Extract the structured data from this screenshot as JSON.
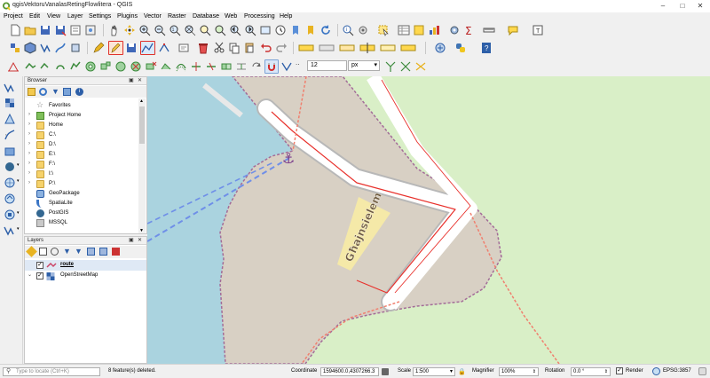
{
  "window": {
    "title": "qgisVektoruVanalasRetingFlowlitera - QGIS"
  },
  "menubar": {
    "items": [
      "Project",
      "Edit",
      "View",
      "Layer",
      "Settings",
      "Plugins",
      "Vector",
      "Raster",
      "Database",
      "Web",
      "Processing",
      "Help"
    ]
  },
  "toolbar": {
    "snapping_tolerance": "12",
    "snapping_unit": "px"
  },
  "browser": {
    "title": "Browser",
    "items": [
      {
        "label": "Favorites",
        "icon": "star-icon"
      },
      {
        "label": "Project Home",
        "icon": "project-home-icon"
      },
      {
        "label": "Home",
        "icon": "folder-icon"
      },
      {
        "label": "C:\\",
        "icon": "folder-icon"
      },
      {
        "label": "D:\\",
        "icon": "folder-icon"
      },
      {
        "label": "E:\\",
        "icon": "folder-icon"
      },
      {
        "label": "F:\\",
        "icon": "folder-icon"
      },
      {
        "label": "I:\\",
        "icon": "folder-icon"
      },
      {
        "label": "P:\\",
        "icon": "folder-icon"
      },
      {
        "label": "GeoPackage",
        "icon": "geopackage-icon"
      },
      {
        "label": "SpatiaLite",
        "icon": "spatialite-icon"
      },
      {
        "label": "PostGIS",
        "icon": "postgis-icon"
      },
      {
        "label": "MSSQL",
        "icon": "mssql-icon"
      }
    ]
  },
  "layers": {
    "title": "Layers",
    "items": [
      {
        "label": "route",
        "checked": true,
        "icon": "line-layer-icon"
      },
      {
        "label": "OpenStreetMap",
        "checked": true,
        "icon": "raster-layer-icon"
      }
    ]
  },
  "map": {
    "place_label": "Għajnsielem",
    "colors": {
      "water": "#aad3df",
      "grass": "#d9efc7",
      "pier": "#d8d0c4",
      "pier_road": "#ffffff",
      "sand": "#f5e9a8",
      "route": "#e8312c",
      "ferry": "#6f8fe8",
      "footway": "#f07f6e",
      "anchor": "#7a3c8c"
    }
  },
  "status": {
    "locate_placeholder": "Type to locate (Ctrl+K)",
    "message": "8 feature(s) deleted.",
    "coordinate_label": "Coordinate",
    "coordinate_value": "1594600.0,4307266.3",
    "scale_label": "Scale",
    "scale_value": "1:500",
    "magnifier_label": "Magnifier",
    "magnifier_value": "100%",
    "rotation_label": "Rotation",
    "rotation_value": "0.0 °",
    "render_label": "Render",
    "crs_label": "EPSG:3857"
  }
}
